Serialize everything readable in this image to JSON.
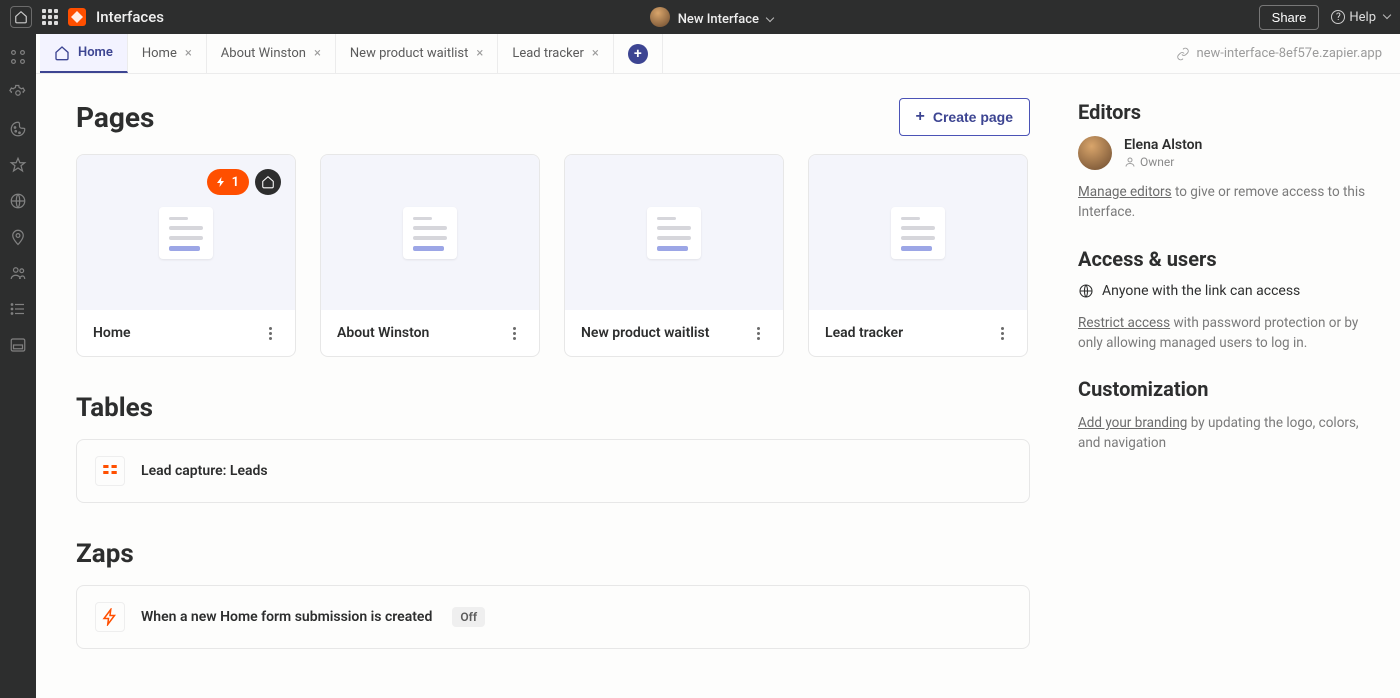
{
  "topbar": {
    "app_title": "Interfaces",
    "project_name": "New Interface",
    "share_label": "Share",
    "help_label": "Help"
  },
  "tabs": {
    "items": [
      {
        "label": "Home",
        "active": true,
        "closable": false,
        "has_icon": true
      },
      {
        "label": "Home",
        "active": false,
        "closable": true
      },
      {
        "label": "About Winston",
        "active": false,
        "closable": true
      },
      {
        "label": "New product waitlist",
        "active": false,
        "closable": true
      },
      {
        "label": "Lead tracker",
        "active": false,
        "closable": true
      }
    ],
    "url": "new-interface-8ef57e.zapier.app"
  },
  "pages": {
    "heading": "Pages",
    "create_label": "Create page",
    "cards": [
      {
        "title": "Home",
        "badge_count": "1",
        "is_home": true
      },
      {
        "title": "About Winston"
      },
      {
        "title": "New product waitlist"
      },
      {
        "title": "Lead tracker"
      }
    ]
  },
  "tables": {
    "heading": "Tables",
    "rows": [
      {
        "label": "Lead capture: Leads"
      }
    ]
  },
  "zaps": {
    "heading": "Zaps",
    "rows": [
      {
        "label": "When a new Home form submission is created",
        "status": "Off"
      }
    ]
  },
  "sidebar": {
    "editors_heading": "Editors",
    "editor": {
      "name": "Elena Alston",
      "role": "Owner"
    },
    "manage_link": "Manage editors",
    "manage_rest": " to give or remove access to this Interface.",
    "access_heading": "Access & users",
    "access_status": "Anyone with the link can access",
    "restrict_link": "Restrict access",
    "restrict_rest": " with password protection or by only allowing managed users to log in.",
    "custom_heading": "Customization",
    "brand_link": "Add your branding",
    "brand_rest": " by updating the logo, colors, and navigation"
  }
}
